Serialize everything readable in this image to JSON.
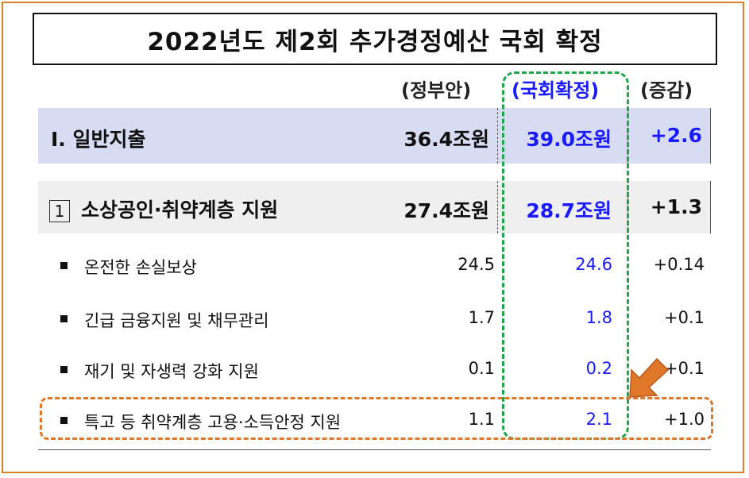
{
  "title": "2022년도 제2회 추가경정예산 국회 확정",
  "headers": {
    "government": "(정부안)",
    "national_assembly": "(국회확정)",
    "change": "(증감)"
  },
  "general_expenditure": {
    "label": "Ⅰ. 일반지출",
    "government": "36.4조원",
    "national_assembly": "39.0조원",
    "change": "+2.6"
  },
  "small_business": {
    "marker": "1",
    "label": "소상공인·취약계층 지원",
    "government": "27.4조원",
    "national_assembly": "28.7조원",
    "change": "+1.3"
  },
  "items": [
    {
      "label": "온전한 손실보상",
      "government": "24.5",
      "national_assembly": "24.6",
      "change": "+0.14"
    },
    {
      "label": "긴급 금융지원 및 채무관리",
      "government": "1.7",
      "national_assembly": "1.8",
      "change": "+0.1"
    },
    {
      "label": "재기 및 자생력 강화 지원",
      "government": "0.1",
      "national_assembly": "0.2",
      "change": "+0.1"
    },
    {
      "label": "특고 등 취약계층 고용·소득안정 지원",
      "government": "1.1",
      "national_assembly": "2.1",
      "change": "+1.0"
    }
  ],
  "colors": {
    "highlight_column": "#1fa84a",
    "highlight_row": "#e0782c",
    "national_assembly_text": "#1a1aff",
    "general_band": "#d8dcf2"
  },
  "icons": {
    "arrow": "down-left-arrow-icon"
  }
}
